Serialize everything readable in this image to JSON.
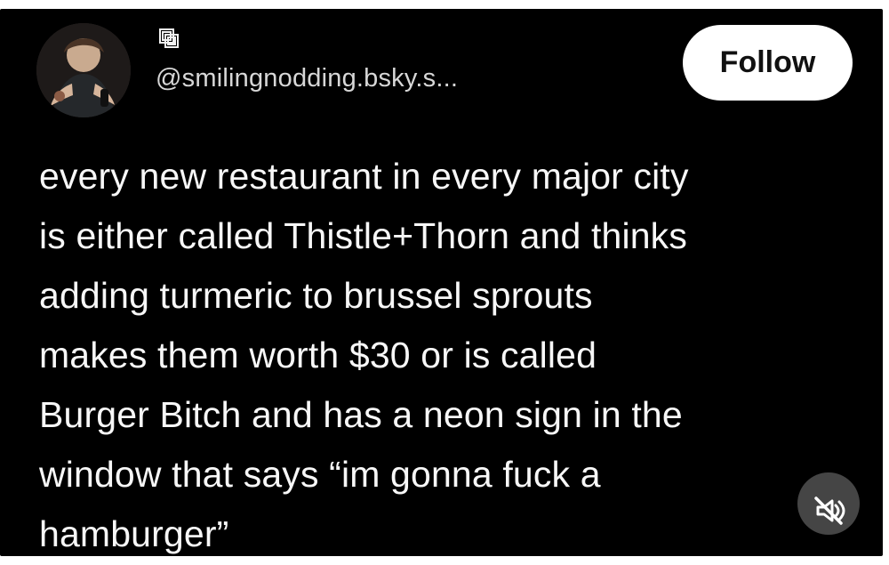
{
  "post": {
    "author": {
      "handle": "@smilingnodding.bsky.s..."
    },
    "actions": {
      "follow_label": "Follow",
      "mute_label": "Muted video"
    },
    "text": "every new restaurant in every major city\nis either called Thistle+Thorn and thinks\nadding turmeric to brussel sprouts\nmakes them worth $30 or is called\nBurger Bitch and has a neon sign in the\nwindow that says “im gonna fuck a\nhamburger”"
  },
  "icons": {
    "repost": "repost-icon",
    "mute": "speaker-muted-icon"
  },
  "colors": {
    "background": "#000000",
    "text": "#f7f7f7",
    "muted_text": "#d7d7d7",
    "button": "#ffffff",
    "button_text": "#111111",
    "mute_button": "#484848"
  }
}
